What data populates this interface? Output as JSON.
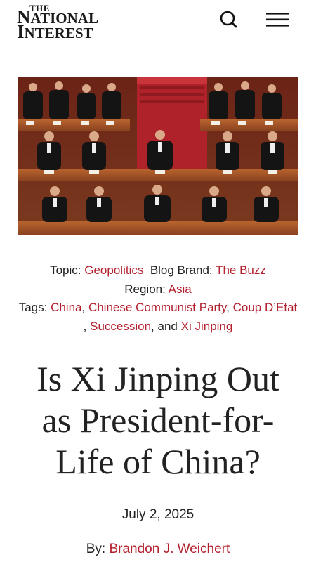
{
  "brand": {
    "logo_the": "THE",
    "logo_line1_initial": "N",
    "logo_line1_rest": "ATIONAL",
    "logo_line2_initial": "I",
    "logo_line2_rest": "NTEREST"
  },
  "header": {
    "search_icon": "search-icon",
    "menu_icon": "hamburger-menu-icon"
  },
  "meta": {
    "topic_label": "Topic:",
    "topic_value": "Geopolitics",
    "blog_brand_label": "Blog Brand:",
    "blog_brand_value": "The Buzz",
    "region_label": "Region:",
    "region_value": "Asia",
    "tags_label": "Tags:",
    "tags": [
      "China",
      "Chinese Communist Party",
      "Coup D’Etat",
      "Succession",
      "Xi Jinping"
    ],
    "tags_sep_comma": ",",
    "tags_and": "and"
  },
  "article": {
    "title_line1": "Is Xi Jinping Out",
    "title_line2": "as President-for-",
    "title_line3": "Life of China?",
    "date": "July 2, 2025",
    "byline_label": "By:",
    "author": "Brandon J. Weichert"
  },
  "colors": {
    "link": "#b3202e",
    "text": "#222222"
  }
}
